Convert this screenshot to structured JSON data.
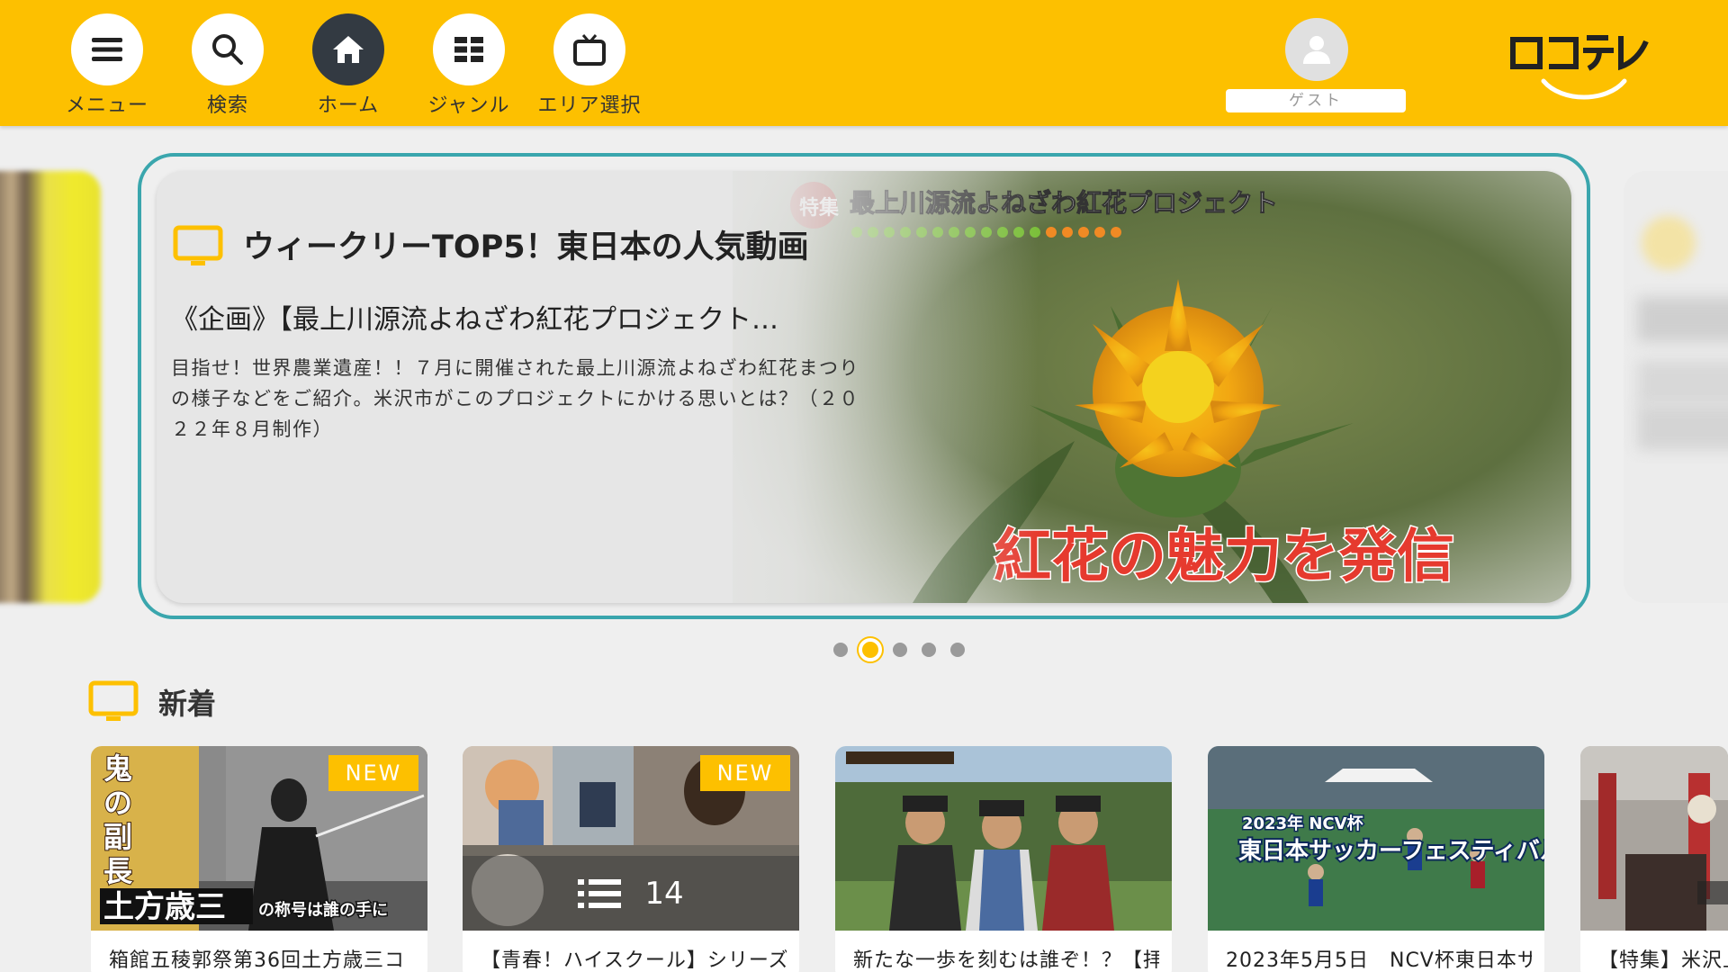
{
  "header": {
    "nav": [
      {
        "label": "メニュー",
        "icon": "menu-icon"
      },
      {
        "label": "検索",
        "icon": "search-icon"
      },
      {
        "label": "ホーム",
        "icon": "home-icon",
        "active": true
      },
      {
        "label": "ジャンル",
        "icon": "grid-icon"
      },
      {
        "label": "エリア選択",
        "icon": "tv-icon"
      }
    ],
    "guest_label": "ゲスト",
    "logo_text": "ロコテレ",
    "bg_color": "#fdc000"
  },
  "hero": {
    "title": "ウィークリーTOP5！東日本の人気動画",
    "subtitle": "《企画》【最上川源流よねざわ紅花プロジェクト…",
    "description": "目指せ！世界農業遺産！！７月に開催された最上川源流よねざわ紅花まつりの様子などをご紹介。米沢市がこのプロジェクトにかける思いとは？（２０２２年８月制作）",
    "image_caption_top": "最上川源流よねざわ紅花プロジェクト",
    "image_caption_tag": "特集",
    "image_caption_main": "紅花の魅力を発信",
    "frame_color": "#3aa6ad"
  },
  "carousel": {
    "dot_count": 5,
    "active_index": 1
  },
  "new_section": {
    "title": "新着",
    "items": [
      {
        "title": "箱館五稜郭祭第36回土方歳三コ",
        "badge": "NEW",
        "img_text_vertical": "鬼の副長",
        "img_text_name": "土方歳三",
        "img_text_suffix": "の称号は誰の手に"
      },
      {
        "title": "【青春！ハイスクール】シリーズ",
        "badge": "NEW",
        "playlist_count": "14"
      },
      {
        "title": "新たな一歩を刻むは誰ぞ！？【拝"
      },
      {
        "title": "2023年5月5日　NCV杯東日本サ",
        "img_text_year": "2023年 NCV杯",
        "img_text_main": "東日本サッカーフェスティバル"
      },
      {
        "title": "【特集】米沢上杉"
      }
    ]
  }
}
